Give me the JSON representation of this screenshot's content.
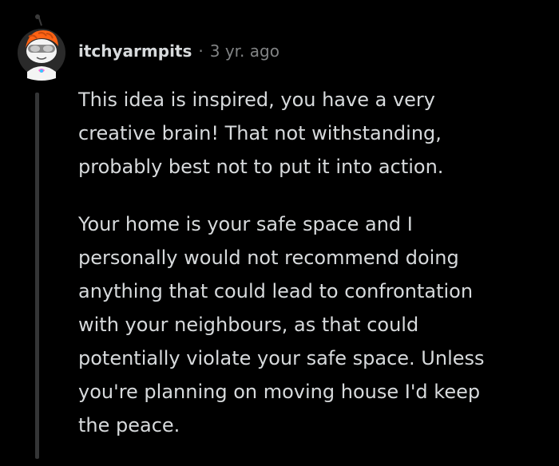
{
  "comment": {
    "avatar_icon": "snoo-avatar-icon",
    "username": "itchyarmpits",
    "separator": "·",
    "timestamp": "3 yr. ago",
    "paragraphs": [
      "This idea is inspired, you have a very\ncreative brain! That not withstanding,\nprobably best not to put it into action.",
      "Your home is your safe space and I\npersonally would not recommend doing\nanything that could lead to confrontation\nwith your neighbours, as that could\npotentially violate your safe space. Unless\nyou're planning on moving house I'd keep\nthe peace."
    ]
  },
  "colors": {
    "background": "#000000",
    "text": "#d7dadc",
    "meta": "#818384",
    "thread_line": "#343536",
    "avatar_accent": "#ff6314"
  }
}
